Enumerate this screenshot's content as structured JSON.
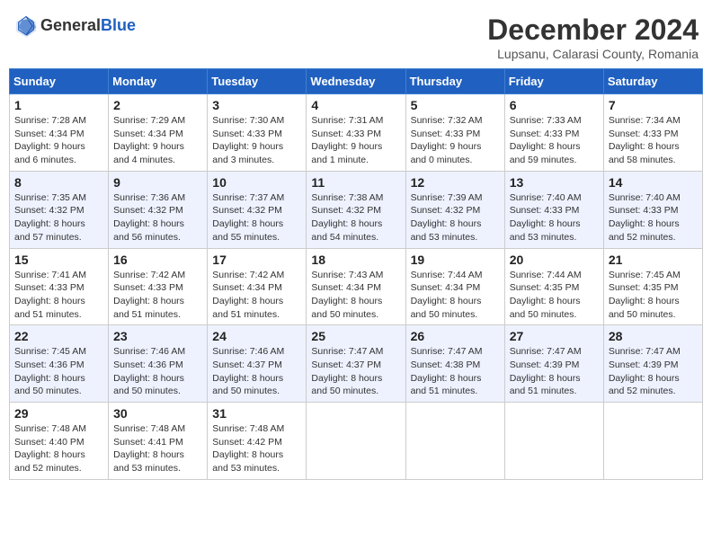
{
  "header": {
    "logo_general": "General",
    "logo_blue": "Blue",
    "month_title": "December 2024",
    "location": "Lupsanu, Calarasi County, Romania"
  },
  "weekdays": [
    "Sunday",
    "Monday",
    "Tuesday",
    "Wednesday",
    "Thursday",
    "Friday",
    "Saturday"
  ],
  "weeks": [
    [
      {
        "day": "1",
        "info": "Sunrise: 7:28 AM\nSunset: 4:34 PM\nDaylight: 9 hours\nand 6 minutes."
      },
      {
        "day": "2",
        "info": "Sunrise: 7:29 AM\nSunset: 4:34 PM\nDaylight: 9 hours\nand 4 minutes."
      },
      {
        "day": "3",
        "info": "Sunrise: 7:30 AM\nSunset: 4:33 PM\nDaylight: 9 hours\nand 3 minutes."
      },
      {
        "day": "4",
        "info": "Sunrise: 7:31 AM\nSunset: 4:33 PM\nDaylight: 9 hours\nand 1 minute."
      },
      {
        "day": "5",
        "info": "Sunrise: 7:32 AM\nSunset: 4:33 PM\nDaylight: 9 hours\nand 0 minutes."
      },
      {
        "day": "6",
        "info": "Sunrise: 7:33 AM\nSunset: 4:33 PM\nDaylight: 8 hours\nand 59 minutes."
      },
      {
        "day": "7",
        "info": "Sunrise: 7:34 AM\nSunset: 4:33 PM\nDaylight: 8 hours\nand 58 minutes."
      }
    ],
    [
      {
        "day": "8",
        "info": "Sunrise: 7:35 AM\nSunset: 4:32 PM\nDaylight: 8 hours\nand 57 minutes."
      },
      {
        "day": "9",
        "info": "Sunrise: 7:36 AM\nSunset: 4:32 PM\nDaylight: 8 hours\nand 56 minutes."
      },
      {
        "day": "10",
        "info": "Sunrise: 7:37 AM\nSunset: 4:32 PM\nDaylight: 8 hours\nand 55 minutes."
      },
      {
        "day": "11",
        "info": "Sunrise: 7:38 AM\nSunset: 4:32 PM\nDaylight: 8 hours\nand 54 minutes."
      },
      {
        "day": "12",
        "info": "Sunrise: 7:39 AM\nSunset: 4:32 PM\nDaylight: 8 hours\nand 53 minutes."
      },
      {
        "day": "13",
        "info": "Sunrise: 7:40 AM\nSunset: 4:33 PM\nDaylight: 8 hours\nand 53 minutes."
      },
      {
        "day": "14",
        "info": "Sunrise: 7:40 AM\nSunset: 4:33 PM\nDaylight: 8 hours\nand 52 minutes."
      }
    ],
    [
      {
        "day": "15",
        "info": "Sunrise: 7:41 AM\nSunset: 4:33 PM\nDaylight: 8 hours\nand 51 minutes."
      },
      {
        "day": "16",
        "info": "Sunrise: 7:42 AM\nSunset: 4:33 PM\nDaylight: 8 hours\nand 51 minutes."
      },
      {
        "day": "17",
        "info": "Sunrise: 7:42 AM\nSunset: 4:34 PM\nDaylight: 8 hours\nand 51 minutes."
      },
      {
        "day": "18",
        "info": "Sunrise: 7:43 AM\nSunset: 4:34 PM\nDaylight: 8 hours\nand 50 minutes."
      },
      {
        "day": "19",
        "info": "Sunrise: 7:44 AM\nSunset: 4:34 PM\nDaylight: 8 hours\nand 50 minutes."
      },
      {
        "day": "20",
        "info": "Sunrise: 7:44 AM\nSunset: 4:35 PM\nDaylight: 8 hours\nand 50 minutes."
      },
      {
        "day": "21",
        "info": "Sunrise: 7:45 AM\nSunset: 4:35 PM\nDaylight: 8 hours\nand 50 minutes."
      }
    ],
    [
      {
        "day": "22",
        "info": "Sunrise: 7:45 AM\nSunset: 4:36 PM\nDaylight: 8 hours\nand 50 minutes."
      },
      {
        "day": "23",
        "info": "Sunrise: 7:46 AM\nSunset: 4:36 PM\nDaylight: 8 hours\nand 50 minutes."
      },
      {
        "day": "24",
        "info": "Sunrise: 7:46 AM\nSunset: 4:37 PM\nDaylight: 8 hours\nand 50 minutes."
      },
      {
        "day": "25",
        "info": "Sunrise: 7:47 AM\nSunset: 4:37 PM\nDaylight: 8 hours\nand 50 minutes."
      },
      {
        "day": "26",
        "info": "Sunrise: 7:47 AM\nSunset: 4:38 PM\nDaylight: 8 hours\nand 51 minutes."
      },
      {
        "day": "27",
        "info": "Sunrise: 7:47 AM\nSunset: 4:39 PM\nDaylight: 8 hours\nand 51 minutes."
      },
      {
        "day": "28",
        "info": "Sunrise: 7:47 AM\nSunset: 4:39 PM\nDaylight: 8 hours\nand 52 minutes."
      }
    ],
    [
      {
        "day": "29",
        "info": "Sunrise: 7:48 AM\nSunset: 4:40 PM\nDaylight: 8 hours\nand 52 minutes."
      },
      {
        "day": "30",
        "info": "Sunrise: 7:48 AM\nSunset: 4:41 PM\nDaylight: 8 hours\nand 53 minutes."
      },
      {
        "day": "31",
        "info": "Sunrise: 7:48 AM\nSunset: 4:42 PM\nDaylight: 8 hours\nand 53 minutes."
      },
      {
        "day": "",
        "info": ""
      },
      {
        "day": "",
        "info": ""
      },
      {
        "day": "",
        "info": ""
      },
      {
        "day": "",
        "info": ""
      }
    ]
  ]
}
